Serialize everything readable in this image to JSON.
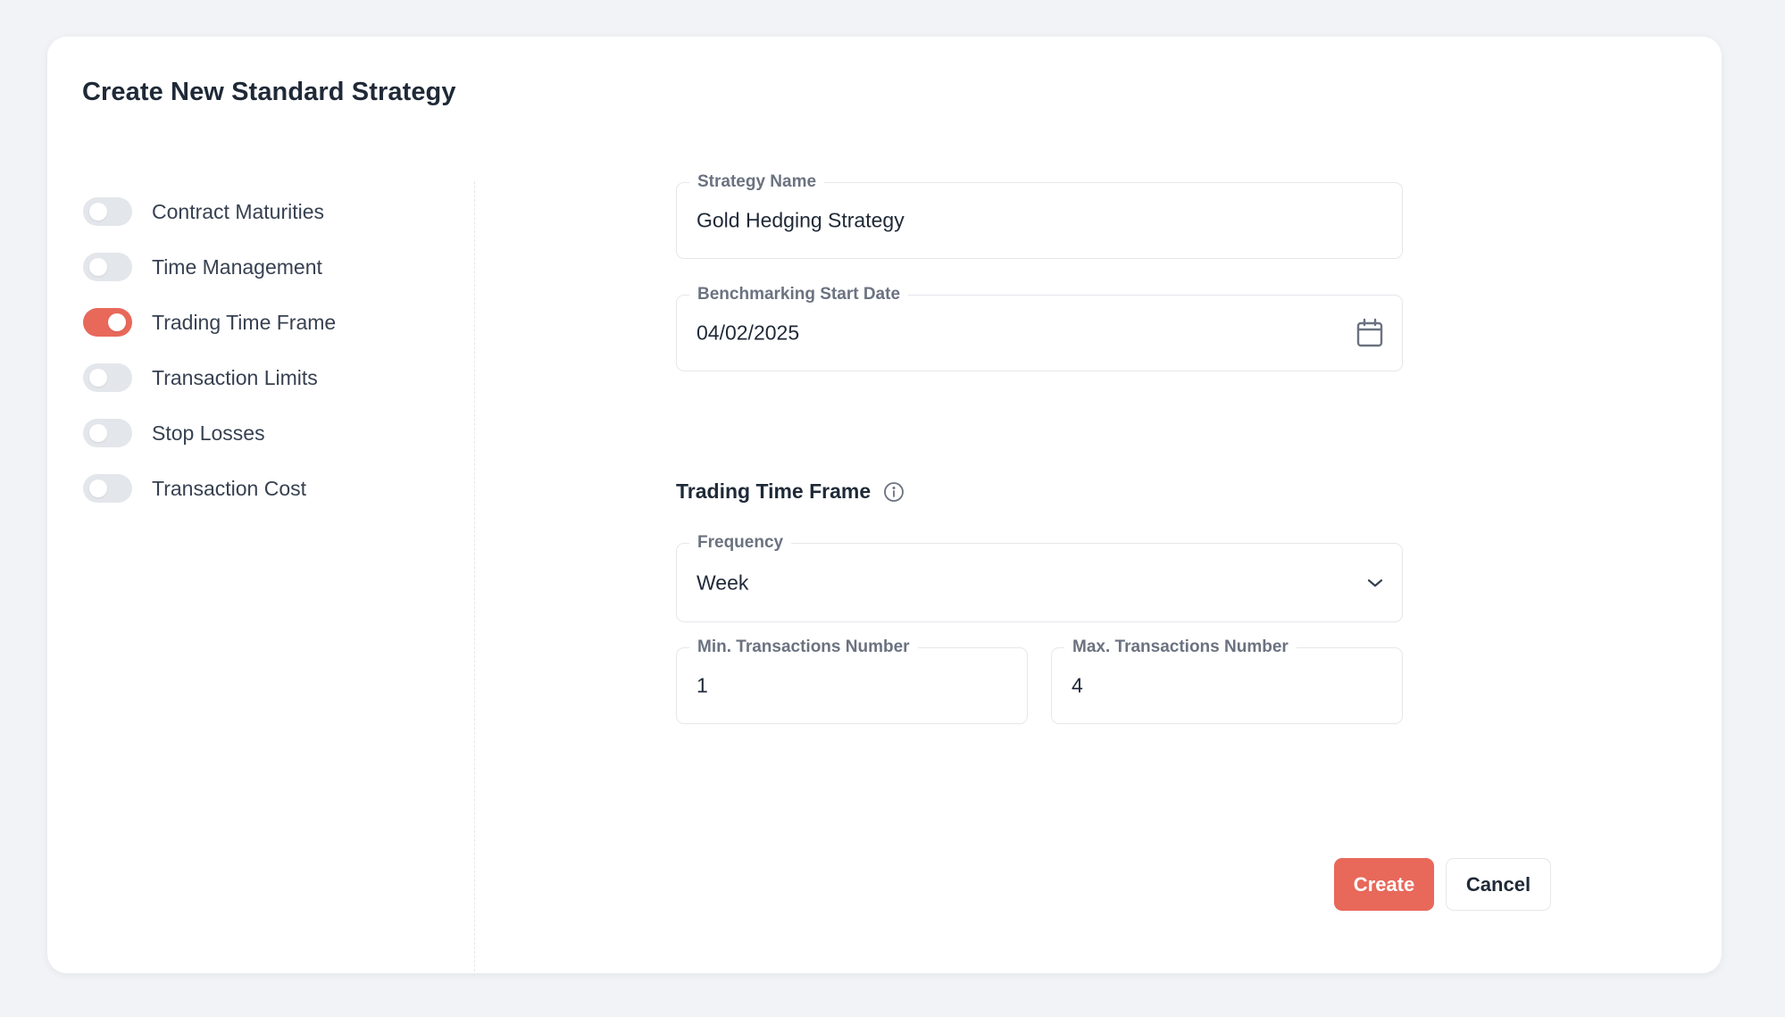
{
  "dialog": {
    "title": "Create New Standard Strategy"
  },
  "toggles": [
    {
      "label": "Contract Maturities",
      "on": false
    },
    {
      "label": "Time Management",
      "on": false
    },
    {
      "label": "Trading Time Frame",
      "on": true
    },
    {
      "label": "Transaction Limits",
      "on": false
    },
    {
      "label": "Stop Losses",
      "on": false
    },
    {
      "label": "Transaction Cost",
      "on": false
    }
  ],
  "form": {
    "strategy_name": {
      "label": "Strategy Name",
      "value": "Gold Hedging Strategy"
    },
    "start_date": {
      "label": "Benchmarking Start Date",
      "value": "04/02/2025",
      "icon": "calendar-icon"
    }
  },
  "trading_time_frame": {
    "title": "Trading Time Frame",
    "info_icon": "info-icon",
    "frequency": {
      "label": "Frequency",
      "value": "Week",
      "icon": "chevron-down-icon"
    },
    "min_transactions": {
      "label": "Min. Transactions Number",
      "value": "1"
    },
    "max_transactions": {
      "label": "Max. Transactions Number",
      "value": "4"
    }
  },
  "actions": {
    "create_label": "Create",
    "cancel_label": "Cancel"
  },
  "colors": {
    "accent": "#e8685a",
    "toggle_off": "#e3e6ea",
    "page_bg": "#f1f3f6"
  }
}
